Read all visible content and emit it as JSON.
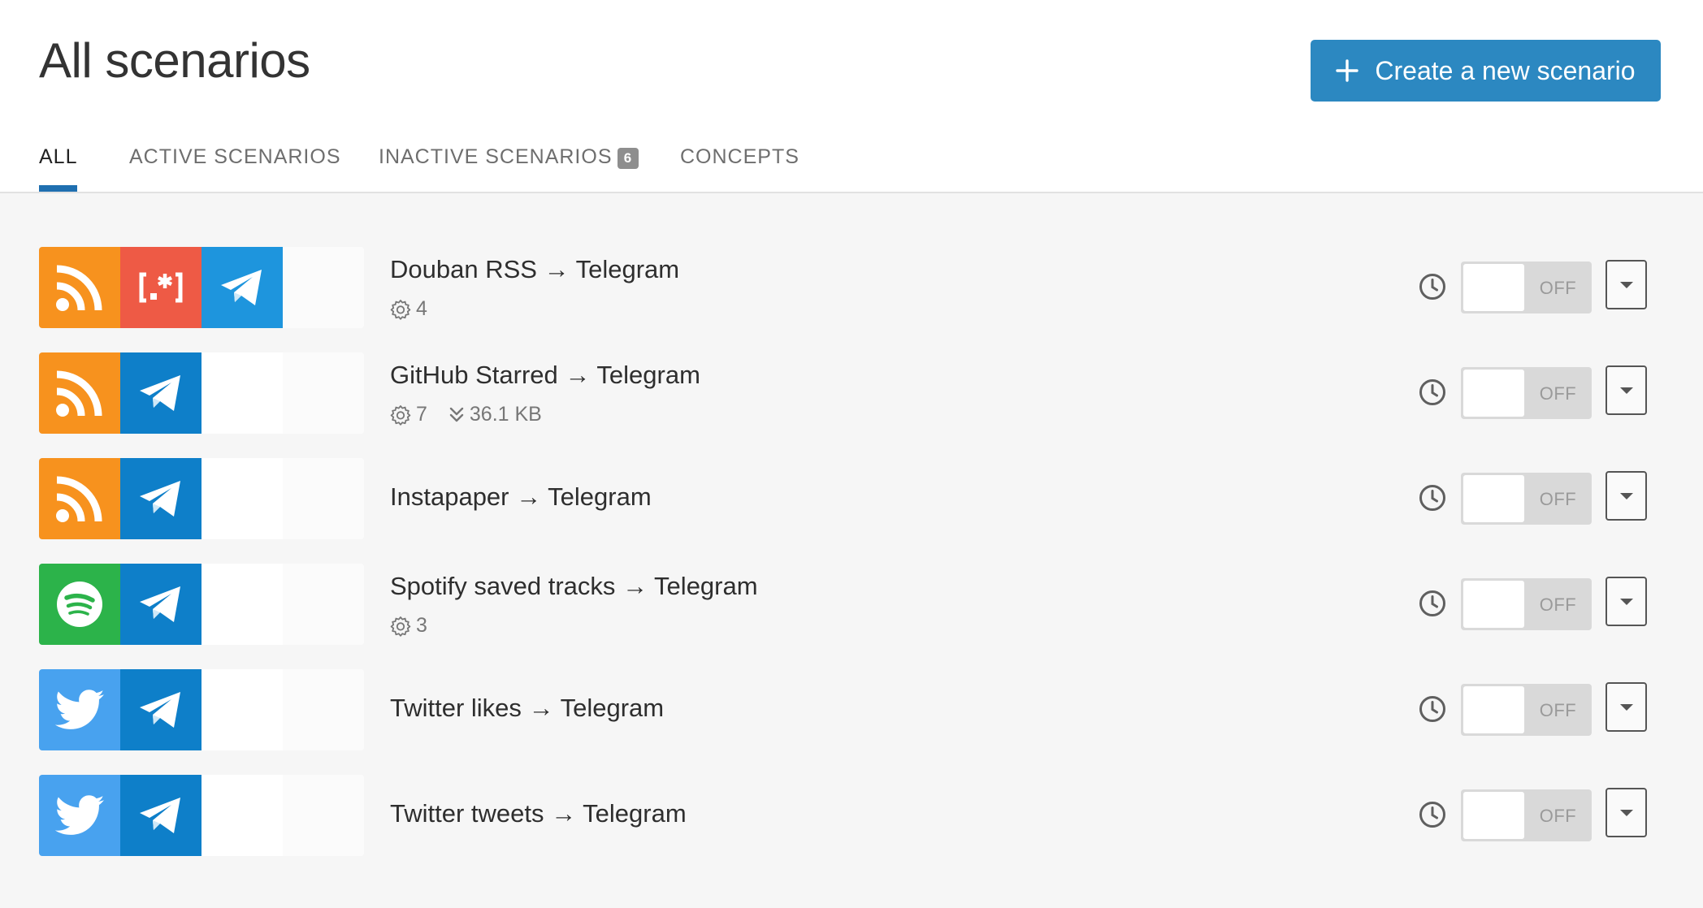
{
  "page": {
    "title": "All scenarios",
    "create_button_label": "Create a new scenario"
  },
  "tabs": [
    {
      "label": "ALL",
      "active": true
    },
    {
      "label": "ACTIVE SCENARIOS",
      "active": false
    },
    {
      "label": "INACTIVE SCENARIOS",
      "active": false,
      "badge": "6"
    },
    {
      "label": "CONCEPTS",
      "active": false
    }
  ],
  "colors": {
    "accent": "#2c88c1",
    "tab_underline": "#1f6fb0",
    "rss": "#f7921e",
    "regex": "#ee5a45",
    "telegram_light": "#1e95dd",
    "telegram_dark": "#0e7fc9",
    "spotify": "#2cb34a",
    "twitter": "#48a2ef"
  },
  "scenarios": [
    {
      "name": "Douban RSS → Telegram",
      "apps": [
        "rss-icon",
        "regex-icon",
        "telegram-icon"
      ],
      "operations": "4",
      "data_transfer": null,
      "toggle": "OFF"
    },
    {
      "name": "GitHub Starred → Telegram",
      "apps": [
        "rss-icon",
        "telegram-icon"
      ],
      "operations": "7",
      "data_transfer": "36.1 KB",
      "toggle": "OFF"
    },
    {
      "name": "Instapaper → Telegram",
      "apps": [
        "rss-icon",
        "telegram-icon"
      ],
      "operations": null,
      "data_transfer": null,
      "toggle": "OFF"
    },
    {
      "name": "Spotify saved tracks → Telegram",
      "apps": [
        "spotify-icon",
        "telegram-icon"
      ],
      "operations": "3",
      "data_transfer": null,
      "toggle": "OFF"
    },
    {
      "name": "Twitter likes → Telegram",
      "apps": [
        "twitter-icon",
        "telegram-icon"
      ],
      "operations": null,
      "data_transfer": null,
      "toggle": "OFF"
    },
    {
      "name": "Twitter tweets → Telegram",
      "apps": [
        "twitter-icon",
        "telegram-icon"
      ],
      "operations": null,
      "data_transfer": null,
      "toggle": "OFF"
    }
  ]
}
